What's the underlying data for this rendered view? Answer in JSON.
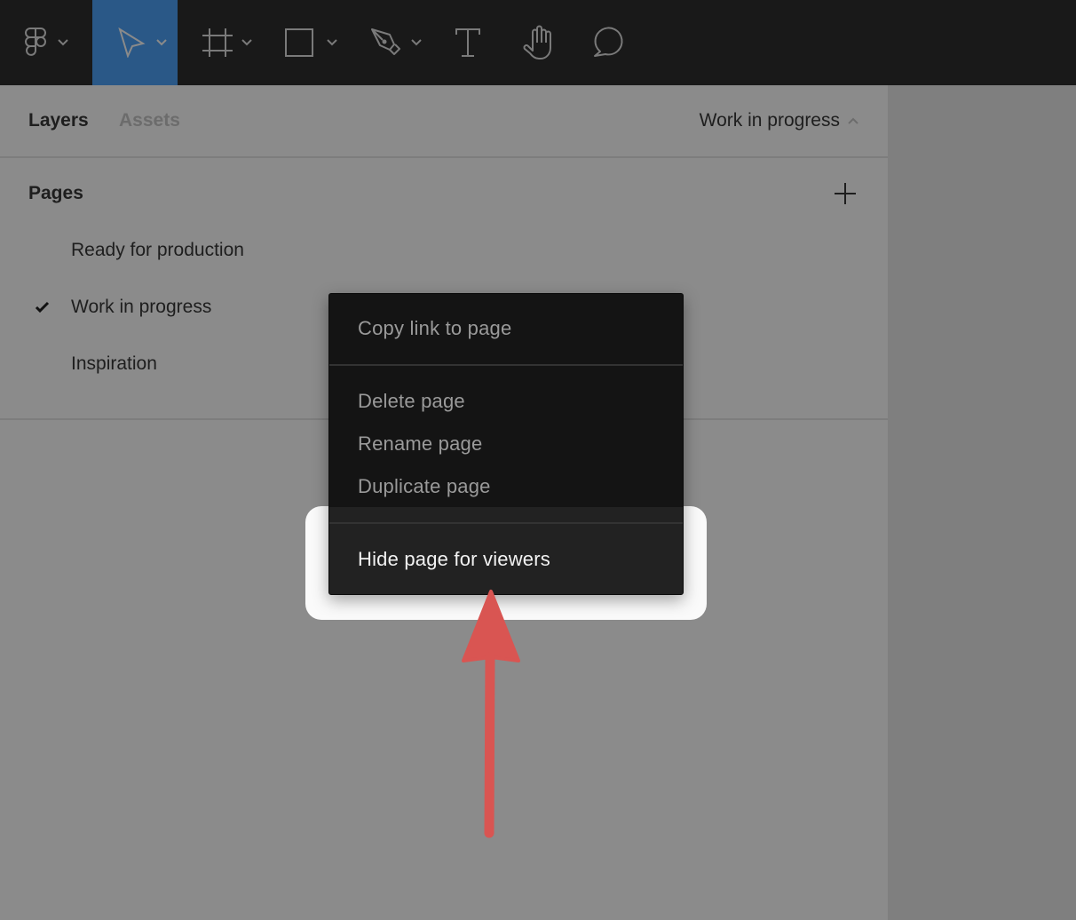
{
  "toolbar": {
    "tools": [
      {
        "name": "main-menu",
        "icon": "figma-logo-icon",
        "has_caret": true,
        "active": false
      },
      {
        "name": "move-tool",
        "icon": "cursor-arrow-icon",
        "has_caret": true,
        "active": true
      },
      {
        "name": "frame-tool",
        "icon": "frame-hash-icon",
        "has_caret": true,
        "active": false
      },
      {
        "name": "shape-tool",
        "icon": "rectangle-icon",
        "has_caret": true,
        "active": false
      },
      {
        "name": "pen-tool",
        "icon": "pen-nib-icon",
        "has_caret": true,
        "active": false
      },
      {
        "name": "text-tool",
        "icon": "text-t-icon",
        "has_caret": false,
        "active": false
      },
      {
        "name": "hand-tool",
        "icon": "hand-icon",
        "has_caret": false,
        "active": false
      },
      {
        "name": "comment-tool",
        "icon": "speech-bubble-icon",
        "has_caret": false,
        "active": false
      }
    ],
    "colors": {
      "background": "#191919",
      "active": "#2a5887",
      "icon": "#7a7a7a"
    }
  },
  "panel": {
    "tabs": [
      {
        "label": "Layers",
        "active": true
      },
      {
        "label": "Assets",
        "active": false
      }
    ],
    "current_page_switcher": {
      "label": "Work in progress",
      "icon": "chevron-up-icon"
    },
    "pages_section": {
      "title": "Pages",
      "add_icon": "plus-icon",
      "items": [
        {
          "label": "Ready for production",
          "current": false
        },
        {
          "label": "Work in progress",
          "current": true
        },
        {
          "label": "Inspiration",
          "current": false
        }
      ]
    }
  },
  "context_menu": {
    "groups": [
      [
        {
          "label": "Copy link to page",
          "highlighted": false
        }
      ],
      [
        {
          "label": "Delete page",
          "highlighted": false
        },
        {
          "label": "Rename page",
          "highlighted": false
        },
        {
          "label": "Duplicate page",
          "highlighted": false
        }
      ],
      [
        {
          "label": "Hide page for viewers",
          "highlighted": true
        }
      ]
    ]
  },
  "annotation": {
    "type": "arrow-up",
    "color": "#d95552",
    "points_to": "Hide page for viewers"
  }
}
